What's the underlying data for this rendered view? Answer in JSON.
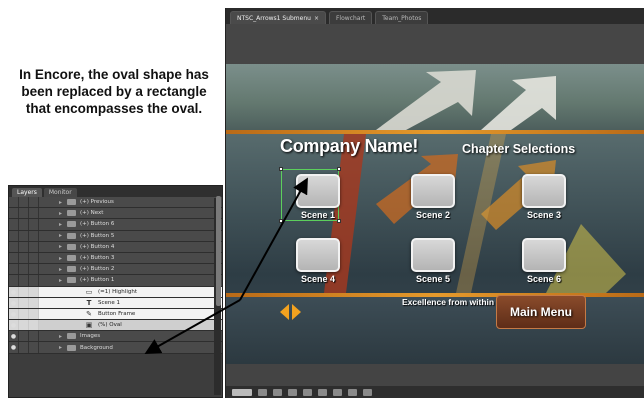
{
  "caption": "In Encore, the oval shape has been replaced by a rectangle that encompasses the oval.",
  "encore": {
    "tabs": [
      {
        "label": "NTSC_Arrows1 Submenu",
        "active": true
      },
      {
        "label": "Flowchart",
        "active": false
      },
      {
        "label": "Team_Photos",
        "active": false
      }
    ],
    "tab_close": "×",
    "menu": {
      "company_name": "Company Name!",
      "chapter_title": "Chapter Selections",
      "scenes": [
        "Scene 1",
        "Scene 2",
        "Scene 3",
        "Scene 4",
        "Scene 5",
        "Scene 6"
      ],
      "tagline": "Excellence from within",
      "main_menu_button": "Main Menu"
    },
    "colors": {
      "accent_orange": "#e59a2c",
      "selection_green": "#5ccf5c",
      "button_brown": "#7a3f22"
    }
  },
  "layers_panel": {
    "tabs": [
      "Layers",
      "Monitor"
    ],
    "rows": [
      {
        "label": "(+) Previous",
        "child": false
      },
      {
        "label": "(+) Next",
        "child": false
      },
      {
        "label": "(+) Button 6",
        "child": false
      },
      {
        "label": "(+) Button 5",
        "child": false
      },
      {
        "label": "(+) Button 4",
        "child": false
      },
      {
        "label": "(+) Button 3",
        "child": false
      },
      {
        "label": "(+) Button 2",
        "child": false
      },
      {
        "label": "(+) Button 1",
        "child": false
      },
      {
        "label": "(=1) Highlight",
        "child": true,
        "icon": "rect-icon"
      },
      {
        "label": "Scene 1",
        "child": true,
        "icon": "text-icon"
      },
      {
        "label": "Button Frame",
        "child": true,
        "icon": "brush-icon"
      },
      {
        "label": "(%) Oval",
        "child": true,
        "icon": "image-icon",
        "selected": true
      },
      {
        "label": "Images",
        "child": false
      },
      {
        "label": "Background",
        "child": false
      }
    ]
  }
}
